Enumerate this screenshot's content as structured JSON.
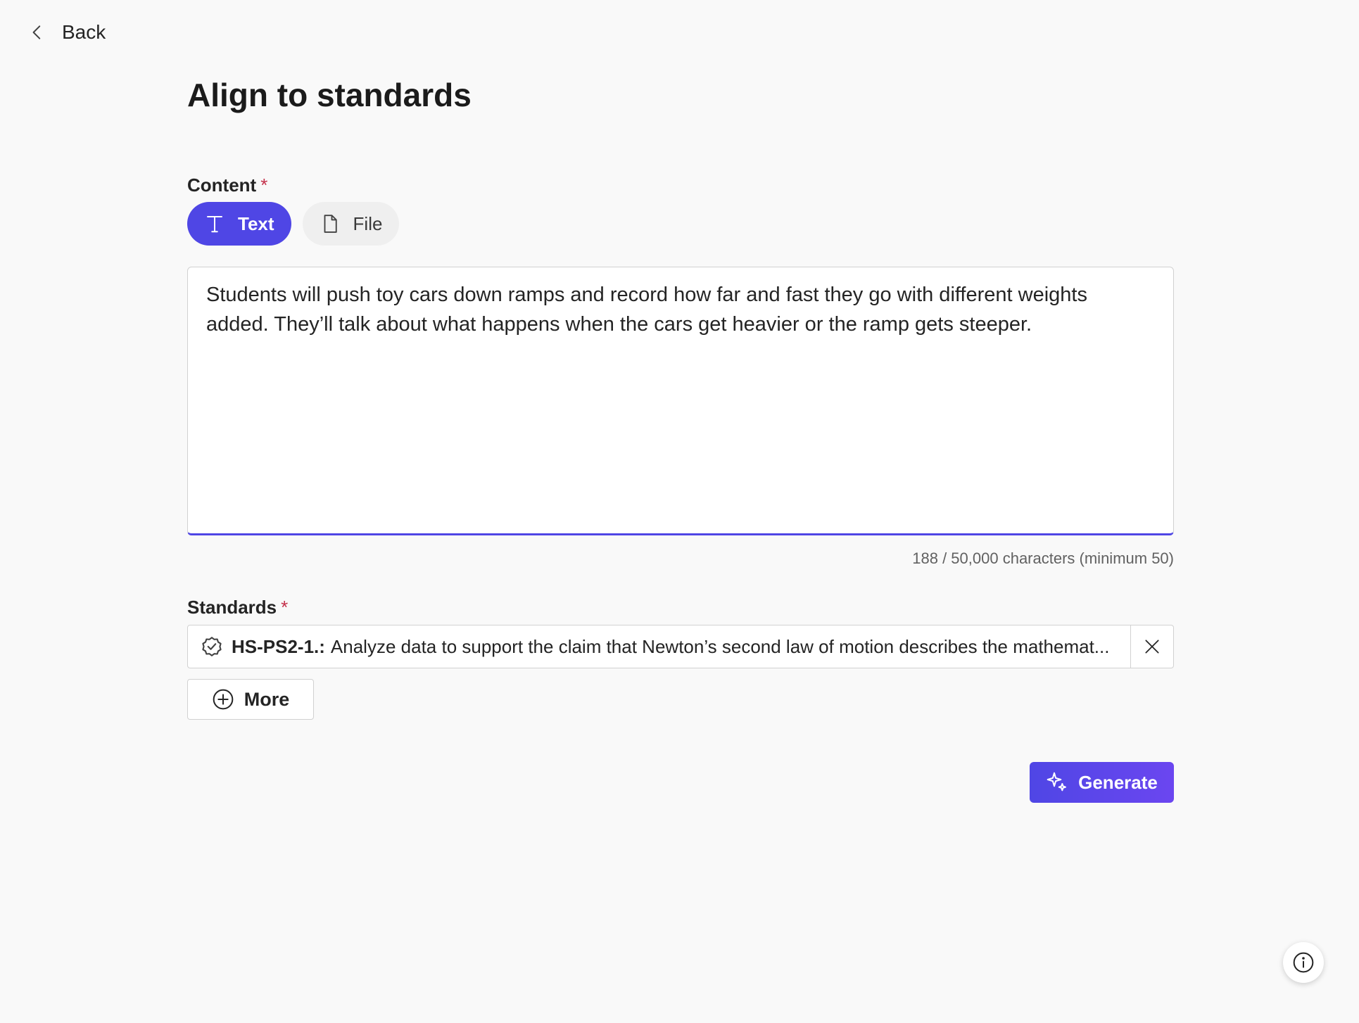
{
  "nav": {
    "back_label": "Back"
  },
  "page": {
    "title": "Align to standards"
  },
  "content": {
    "label": "Content",
    "required_marker": "*",
    "tabs": [
      {
        "label": "Text",
        "icon": "text-icon",
        "selected": true
      },
      {
        "label": "File",
        "icon": "file-icon",
        "selected": false
      }
    ],
    "text_value": "Students will push toy cars down ramps and record how far and fast they go with different weights added. They’ll talk about what happens when the cars get heavier or the ramp gets steeper.",
    "counter": "188 / 50,000 characters (minimum 50)"
  },
  "standards": {
    "label": "Standards",
    "required_marker": "*",
    "items": [
      {
        "code": "HS-PS2-1.:",
        "description": "Analyze data to support the claim that Newton’s second law of motion describes the mathemat...",
        "icon": "badge-check-icon"
      }
    ],
    "more_label": "More"
  },
  "actions": {
    "generate_label": "Generate"
  },
  "colors": {
    "accent": "#4f46e5",
    "required": "#c4314b"
  }
}
